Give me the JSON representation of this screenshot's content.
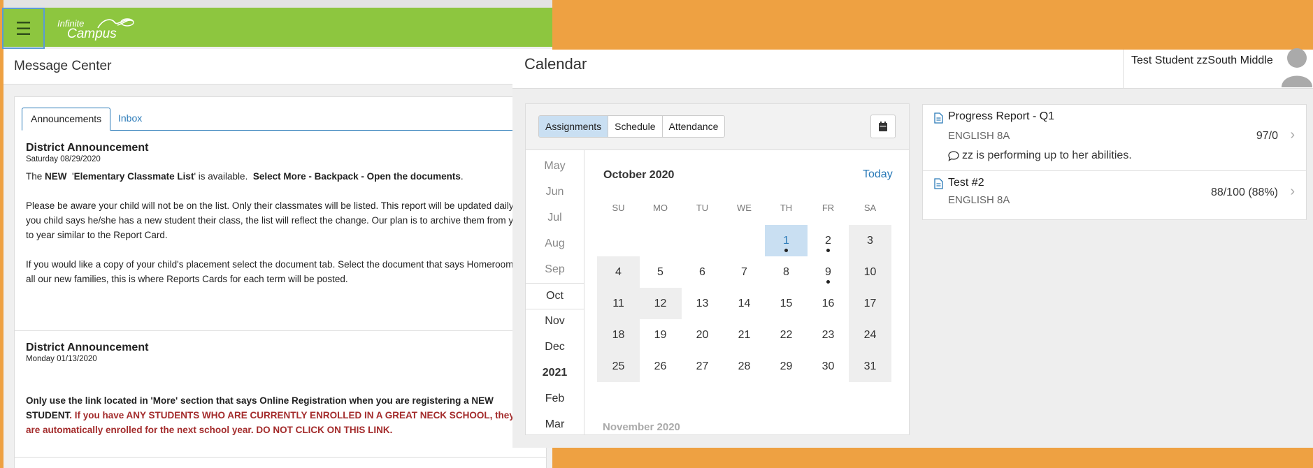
{
  "left": {
    "brand": {
      "line1": "Infinite",
      "line2": "Campus"
    },
    "menu_icon": "hamburger-icon",
    "page_title": "Message Center",
    "tabs": [
      {
        "label": "Announcements"
      },
      {
        "label": "Inbox"
      }
    ],
    "announcements": [
      {
        "title": "District Announcement",
        "date": "Saturday 08/29/2020",
        "p1": {
          "a": "The ",
          "b": "NEW",
          "c": "  '",
          "d": "Elementary Classmate List",
          "e": "' is available.  ",
          "f": "Select More - Backpack - Open the documents",
          "g": "."
        },
        "p2": "  Please be aware your child will not be on the list. Only their classmates will be listed.  This report will be updated daily. If you child says he/she has a new student their class, the list will reflect the change.   Our plan is to archive them from year to year similar to the Report Card.",
        "p3": " If you would like a copy of your child's placement select the document tab.  Select the document that says Homeroom.  To all our new families, this is where Reports Cards for each term will be posted."
      },
      {
        "title": "District Announcement",
        "date": "Monday 01/13/2020",
        "p1_bold": "Only use the link located in 'More' section that says Online Registration when you are registering a NEW STUDENT",
        "p1_red": ". If you have ANY STUDENTS WHO ARE CURRENTLY ENROLLED IN A GREAT NECK SCHOOL, they are automatically enrolled for the next school year. DO NOT CLICK ON THIS LINK."
      }
    ]
  },
  "right": {
    "page_title": "Calendar",
    "user_name": "Test Student zzSouth Middle",
    "view_buttons": [
      {
        "label": "Assignments"
      },
      {
        "label": "Schedule"
      },
      {
        "label": "Attendance"
      }
    ],
    "months": [
      "May",
      "Jun",
      "Jul",
      "Aug",
      "Sep",
      "Oct",
      "Nov",
      "Dec",
      "2021",
      "Feb",
      "Mar"
    ],
    "current_month": "Oct",
    "month_label": "October 2020",
    "today_label": "Today",
    "weekdays": [
      "SU",
      "MO",
      "TU",
      "WE",
      "TH",
      "FR",
      "SA"
    ],
    "days": [
      "1",
      "2",
      "3",
      "4",
      "5",
      "6",
      "7",
      "8",
      "9",
      "10",
      "11",
      "12",
      "13",
      "14",
      "15",
      "16",
      "17",
      "18",
      "19",
      "20",
      "21",
      "22",
      "23",
      "24",
      "25",
      "26",
      "27",
      "28",
      "29",
      "30",
      "31"
    ],
    "selected_day": "1",
    "days_with_events": [
      "1",
      "2",
      "9"
    ],
    "next_month_label": "November 2020",
    "items": [
      {
        "title": "Progress Report - Q1",
        "course": "ENGLISH 8A",
        "score": "97/0",
        "comment": "zz is performing up to her abilities."
      },
      {
        "title": "Test #2",
        "course": "ENGLISH 8A",
        "score": "88/100  (88%)"
      }
    ]
  },
  "colors": {
    "green": "#8dc63f",
    "orange": "#eea142",
    "blue": "#2a7ab8",
    "selected": "#c9dff2",
    "red": "#a32b2b"
  }
}
